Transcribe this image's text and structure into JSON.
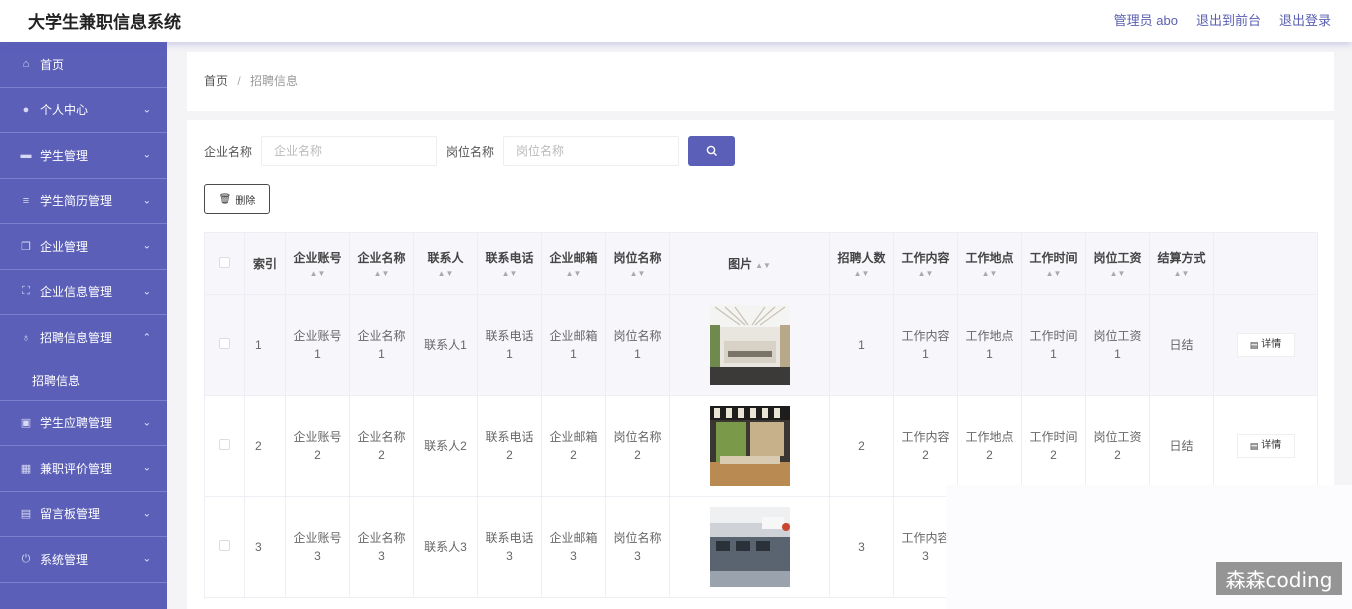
{
  "app": {
    "title": "大学生兼职信息系统"
  },
  "top_links": {
    "admin": "管理员 abo",
    "to_front": "退出到前台",
    "logout": "退出登录"
  },
  "sidebar": {
    "items": [
      {
        "label": "首页",
        "icon": "home-icon",
        "chevron": ""
      },
      {
        "label": "个人中心",
        "icon": "user-icon",
        "chevron": "⌄"
      },
      {
        "label": "学生管理",
        "icon": "chat-icon",
        "chevron": "⌄"
      },
      {
        "label": "学生简历管理",
        "icon": "list-icon",
        "chevron": "⌄"
      },
      {
        "label": "企业管理",
        "icon": "copy-icon",
        "chevron": "⌄"
      },
      {
        "label": "企业信息管理",
        "icon": "frame-icon",
        "chevron": "⌄"
      },
      {
        "label": "招聘信息管理",
        "icon": "mic-icon",
        "chevron": "⌃"
      },
      {
        "label": "学生应聘管理",
        "icon": "check-icon",
        "chevron": "⌄"
      },
      {
        "label": "兼职评价管理",
        "icon": "grid-icon",
        "chevron": "⌄"
      },
      {
        "label": "留言板管理",
        "icon": "calendar-icon",
        "chevron": "⌄"
      },
      {
        "label": "系统管理",
        "icon": "power-icon",
        "chevron": "⌄"
      }
    ],
    "sub_item": "招聘信息"
  },
  "breadcrumb": {
    "home": "首页",
    "sep": "/",
    "current": "招聘信息"
  },
  "search": {
    "company_label": "企业名称",
    "company_placeholder": "企业名称",
    "job_label": "岗位名称",
    "job_placeholder": "岗位名称"
  },
  "toolbar": {
    "delete_label": "删除"
  },
  "table": {
    "headers": [
      "索引",
      "企业账号",
      "企业名称",
      "联系人",
      "联系电话",
      "企业邮箱",
      "岗位名称",
      "图片",
      "招聘人数",
      "工作内容",
      "工作地点",
      "工作时间",
      "岗位工资",
      "结算方式"
    ],
    "detail_label": "详情",
    "rows": [
      {
        "index": "1",
        "account": [
          "企业账号",
          "1"
        ],
        "company": [
          "企业名称",
          "1"
        ],
        "contact": "联系人1",
        "phone": [
          "联系电话",
          "1"
        ],
        "email": [
          "企业邮箱",
          "1"
        ],
        "job": [
          "岗位名称",
          "1"
        ],
        "count": "1",
        "content": [
          "工作内容",
          "1"
        ],
        "place": [
          "工作地点",
          "1"
        ],
        "time": [
          "工作时间",
          "1"
        ],
        "wage": [
          "岗位工资",
          "1"
        ],
        "settle": "日结"
      },
      {
        "index": "2",
        "account": [
          "企业账号",
          "2"
        ],
        "company": [
          "企业名称",
          "2"
        ],
        "contact": "联系人2",
        "phone": [
          "联系电话",
          "2"
        ],
        "email": [
          "企业邮箱",
          "2"
        ],
        "job": [
          "岗位名称",
          "2"
        ],
        "count": "2",
        "content": [
          "工作内容",
          "2"
        ],
        "place": [
          "工作地点",
          "2"
        ],
        "time": [
          "工作时间",
          "2"
        ],
        "wage": [
          "岗位工资",
          "2"
        ],
        "settle": "日结"
      },
      {
        "index": "3",
        "account": [
          "企业账号",
          "3"
        ],
        "company": [
          "企业名称",
          "3"
        ],
        "contact": "联系人3",
        "phone": [
          "联系电话",
          "3"
        ],
        "email": [
          "企业邮箱",
          "3"
        ],
        "job": [
          "岗位名称",
          "3"
        ],
        "count": "3",
        "content": [
          "工作内容",
          "3"
        ],
        "place": [
          "",
          ""
        ],
        "time": [
          "",
          ""
        ],
        "wage": [
          "",
          ""
        ],
        "settle": ""
      }
    ]
  },
  "watermark": "森森coding",
  "colors": {
    "accent": "#5b5fb8",
    "sidebar_bg": "#5b5fb8",
    "header_bg": "#f6f6fb"
  }
}
